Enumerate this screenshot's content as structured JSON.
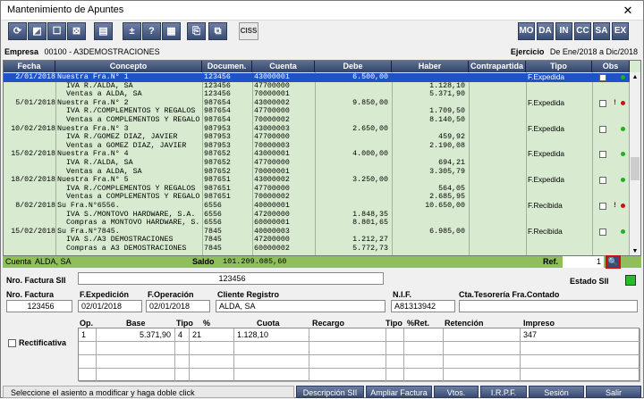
{
  "window": {
    "title": "Mantenimiento de Apuntes",
    "close": "✕"
  },
  "toolbar": {
    "buttons": [
      "⟳",
      "◩",
      "☐",
      "⊠",
      "▤",
      "±",
      "?",
      "▦",
      "⎘",
      "⧉"
    ],
    "ciss": "CISS",
    "modes": [
      "MO",
      "DA",
      "IN",
      "CC",
      "SA",
      "EX"
    ]
  },
  "empresa": {
    "label": "Empresa",
    "value": "00100 - A3DEMOSTRACIONES",
    "ejercicio_label": "Ejercicio",
    "ejercicio_value": "De Ene/2018 a Dic/2018"
  },
  "columns": [
    "Fecha",
    "Concepto",
    "Documen.",
    "Cuenta",
    "Debe",
    "Haber",
    "Contrapartida",
    "Tipo",
    "Obs"
  ],
  "rows": [
    {
      "fecha": "2/01/2018",
      "concepto": "Nuestra Fra.N° 1",
      "doc": "123456",
      "cuenta": "43000001",
      "debe": "6.500,00",
      "haber": "",
      "tipo": "F.Expedida",
      "obs": true,
      "dot": "green",
      "sel": true
    },
    {
      "fecha": "",
      "concepto": "  IVA R./ALDA, SA",
      "doc": "123456",
      "cuenta": "47700000",
      "debe": "",
      "haber": "1.128,10",
      "tipo": "",
      "obs": false,
      "dot": ""
    },
    {
      "fecha": "",
      "concepto": "  Ventas a ALDA, SA",
      "doc": "123456",
      "cuenta": "70000001",
      "debe": "",
      "haber": "5.371,90",
      "tipo": "",
      "obs": false,
      "dot": ""
    },
    {
      "fecha": "5/01/2018",
      "concepto": "Nuestra Fra.N° 2",
      "doc": "987654",
      "cuenta": "43000002",
      "debe": "9.850,00",
      "haber": "",
      "tipo": "F.Expedida",
      "obs": true,
      "dot": "red"
    },
    {
      "fecha": "",
      "concepto": "  IVA R./COMPLEMENTOS Y REGALOS",
      "doc": "987654",
      "cuenta": "47700000",
      "debe": "",
      "haber": "1.709,50",
      "tipo": "",
      "obs": false,
      "dot": ""
    },
    {
      "fecha": "",
      "concepto": "  Ventas a COMPLEMENTOS Y REGALO",
      "doc": "987654",
      "cuenta": "70000002",
      "debe": "",
      "haber": "8.140,50",
      "tipo": "",
      "obs": false,
      "dot": ""
    },
    {
      "fecha": "10/02/2018",
      "concepto": "Nuestra Fra.N° 3",
      "doc": "987953",
      "cuenta": "43000003",
      "debe": "2.650,00",
      "haber": "",
      "tipo": "F.Expedida",
      "obs": true,
      "dot": "green"
    },
    {
      "fecha": "",
      "concepto": "  IVA R./GOMEZ DIAZ, JAVIER",
      "doc": "987953",
      "cuenta": "47700000",
      "debe": "",
      "haber": "459,92",
      "tipo": "",
      "obs": false,
      "dot": ""
    },
    {
      "fecha": "",
      "concepto": "  Ventas a GOMEZ DIAZ, JAVIER",
      "doc": "987953",
      "cuenta": "70000003",
      "debe": "",
      "haber": "2.190,08",
      "tipo": "",
      "obs": false,
      "dot": ""
    },
    {
      "fecha": "15/02/2018",
      "concepto": "Nuestra Fra.N° 4",
      "doc": "987652",
      "cuenta": "43000001",
      "debe": "4.000,00",
      "haber": "",
      "tipo": "F.Expedida",
      "obs": true,
      "dot": "green"
    },
    {
      "fecha": "",
      "concepto": "  IVA R./ALDA, SA",
      "doc": "987652",
      "cuenta": "47700000",
      "debe": "",
      "haber": "694,21",
      "tipo": "",
      "obs": false,
      "dot": ""
    },
    {
      "fecha": "",
      "concepto": "  Ventas a ALDA, SA",
      "doc": "987652",
      "cuenta": "70000001",
      "debe": "",
      "haber": "3.305,79",
      "tipo": "",
      "obs": false,
      "dot": ""
    },
    {
      "fecha": "18/02/2018",
      "concepto": "Nuestra Fra.N° 5",
      "doc": "987651",
      "cuenta": "43000002",
      "debe": "3.250,00",
      "haber": "",
      "tipo": "F.Expedida",
      "obs": true,
      "dot": "green"
    },
    {
      "fecha": "",
      "concepto": "  IVA R./COMPLEMENTOS Y REGALOS",
      "doc": "987651",
      "cuenta": "47700000",
      "debe": "",
      "haber": "564,05",
      "tipo": "",
      "obs": false,
      "dot": ""
    },
    {
      "fecha": "",
      "concepto": "  Ventas a COMPLEMENTOS Y REGALO",
      "doc": "987651",
      "cuenta": "70000002",
      "debe": "",
      "haber": "2.685,95",
      "tipo": "",
      "obs": false,
      "dot": ""
    },
    {
      "fecha": "8/02/2018",
      "concepto": "Su Fra.N°6556.",
      "doc": "6556",
      "cuenta": "40000001",
      "debe": "",
      "haber": "10.650,00",
      "tipo": "F.Recibida",
      "obs": true,
      "dot": "red"
    },
    {
      "fecha": "",
      "concepto": "  IVA S./MONTOVO HARDWARE, S.A.",
      "doc": "6556",
      "cuenta": "47200000",
      "debe": "1.848,35",
      "haber": "",
      "tipo": "",
      "obs": false,
      "dot": ""
    },
    {
      "fecha": "",
      "concepto": "  Compras a MONTOVO HARDWARE, S.",
      "doc": "6556",
      "cuenta": "60000001",
      "debe": "8.801,65",
      "haber": "",
      "tipo": "",
      "obs": false,
      "dot": ""
    },
    {
      "fecha": "15/02/2018",
      "concepto": "Su Fra.N°7845.",
      "doc": "7845",
      "cuenta": "40000003",
      "debe": "",
      "haber": "6.985,00",
      "tipo": "F.Recibida",
      "obs": true,
      "dot": "green"
    },
    {
      "fecha": "",
      "concepto": "  IVA S./A3 DEMOSTRACIONES",
      "doc": "7845",
      "cuenta": "47200000",
      "debe": "1.212,27",
      "haber": "",
      "tipo": "",
      "obs": false,
      "dot": ""
    },
    {
      "fecha": "",
      "concepto": "  Compras a A3 DEMOSTRACIONES",
      "doc": "7845",
      "cuenta": "60000002",
      "debe": "5.772,73",
      "haber": "",
      "tipo": "",
      "obs": false,
      "dot": ""
    }
  ],
  "cuenta_bar": {
    "label": "Cuenta",
    "value": "ALDA, SA",
    "saldo_label": "Saldo",
    "saldo_value": "101.209.085,60",
    "ref_label": "Ref.",
    "ref_value": "1"
  },
  "form": {
    "nro_factura_sii_label": "Nro. Factura SII",
    "nro_factura_sii": "123456",
    "estado_sii_label": "Estado SII",
    "estado_color": "#22c022",
    "nro_factura_label": "Nro. Factura",
    "nro_factura": "123456",
    "f_expedicion_label": "F.Expedición",
    "f_expedicion": "02/01/2018",
    "f_operacion_label": "F.Operación",
    "f_operacion": "02/01/2018",
    "cliente_label": "Cliente Registro",
    "cliente": "ALDA, SA",
    "nif_label": "N.I.F.",
    "nif": "A81313942",
    "cta_tesoreria_label": "Cta.Tesorería Fra.Contado",
    "cta_tesoreria": "",
    "rectificativa_label": "Rectificativa"
  },
  "vat_table": {
    "headers": [
      "Op.",
      "Base",
      "Tipo",
      "%",
      "Cuota",
      "Recargo",
      "Tipo",
      "%Ret.",
      "Retención",
      "Impreso"
    ],
    "row": [
      "1",
      "5.371,90",
      "4",
      "21",
      "1.128,10",
      "",
      "",
      "",
      "",
      "347"
    ]
  },
  "status": "Seleccione el asiento a modificar y haga doble click",
  "buttons": {
    "descripcion": "Descripción SII",
    "ampliar": "Ampliar Factura",
    "vtos": "Vtos.",
    "irpf": "I.R.P.F.",
    "sesion": "Sesión",
    "salir": "Salir"
  }
}
